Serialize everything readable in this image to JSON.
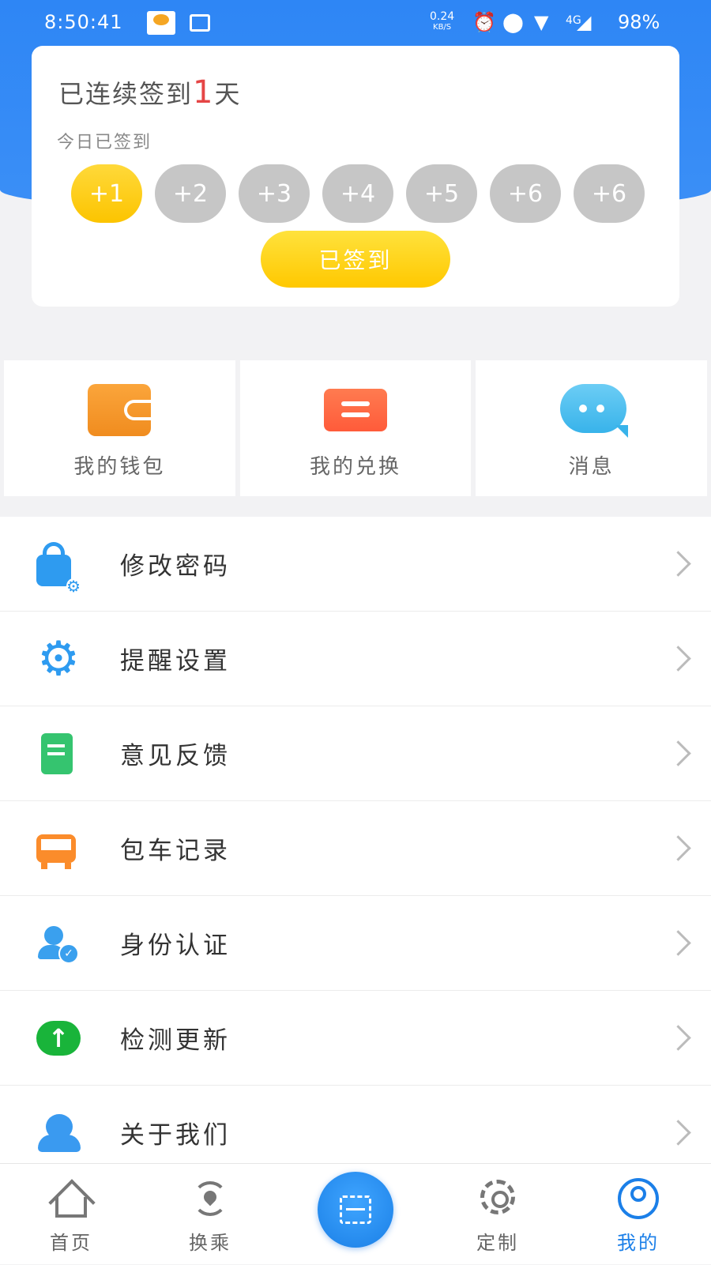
{
  "status_bar": {
    "time": "8:50:41",
    "net_speed": "0.24",
    "net_unit": "KB/S",
    "network": "4G",
    "battery": "98%"
  },
  "checkin": {
    "streak_prefix": "已连续签到",
    "streak_count": "1",
    "streak_suffix": "天",
    "today_status": "今日已签到",
    "days": [
      "+1",
      "+2",
      "+3",
      "+4",
      "+5",
      "+6",
      "+6"
    ],
    "completed_days": 1,
    "button_label": "已签到",
    "accent_color": "#fcc400"
  },
  "quick_actions": [
    {
      "label": "我的钱包",
      "icon": "wallet-icon"
    },
    {
      "label": "我的兑换",
      "icon": "ticket-icon"
    },
    {
      "label": "消息",
      "icon": "message-bubble-icon"
    }
  ],
  "menu": [
    {
      "label": "修改密码",
      "icon": "lock-settings-icon"
    },
    {
      "label": "提醒设置",
      "icon": "gear-icon"
    },
    {
      "label": "意见反馈",
      "icon": "feedback-doc-icon"
    },
    {
      "label": "包车记录",
      "icon": "bus-icon"
    },
    {
      "label": "身份认证",
      "icon": "user-verified-icon"
    },
    {
      "label": "检测更新",
      "icon": "upload-arrow-icon"
    },
    {
      "label": "关于我们",
      "icon": "about-mascot-icon"
    }
  ],
  "tabbar": {
    "items": [
      {
        "label": "首页",
        "icon": "home-icon"
      },
      {
        "label": "换乘",
        "icon": "transfer-icon"
      },
      {
        "label": "定制",
        "icon": "custom-icon"
      },
      {
        "label": "我的",
        "icon": "user-circle-icon"
      }
    ],
    "center_icon": "scan-icon",
    "active_index": 3,
    "active_color": "#1b7fe8"
  },
  "theme": {
    "primary_blue": "#2e86f5",
    "gold": "#ffc800"
  }
}
